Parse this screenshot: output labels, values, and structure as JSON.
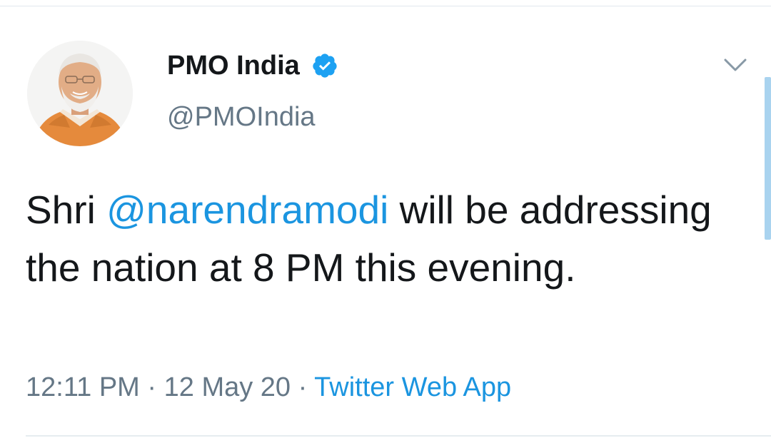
{
  "tweet": {
    "author": {
      "display_name": "PMO India",
      "handle": "@PMOIndia",
      "verified": true
    },
    "text": {
      "before_mention": "Shri ",
      "mention": "@narendramodi",
      "after_mention": " will be addressing the nation at 8 PM this evening."
    },
    "meta": {
      "time": "12:11 PM",
      "separator_1": " · ",
      "date": "12 May 20",
      "separator_2": " · ",
      "source": "Twitter Web App"
    }
  },
  "icons": {
    "verified": "verified-badge-icon",
    "more": "chevron-down-icon"
  },
  "colors": {
    "text": "#14171a",
    "secondary": "#657786",
    "link": "#1b95e0",
    "verified": "#1da1f2",
    "divider": "#e1e8ed",
    "scrollbar": "#a9d3ef"
  }
}
